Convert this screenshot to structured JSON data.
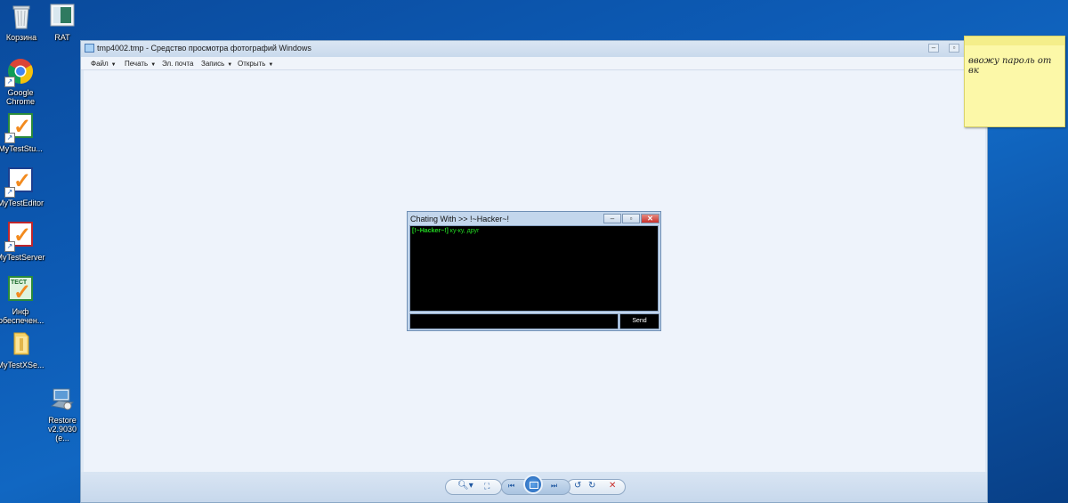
{
  "desktop": {
    "icons": [
      {
        "label": "Корзина",
        "icon": "recycle-bin-icon"
      },
      {
        "label": "RAT",
        "icon": "rat-file-icon"
      },
      {
        "label": "Google Chrome",
        "icon": "chrome-icon"
      },
      {
        "label": "MyTestStu...",
        "icon": "mytest-student-icon"
      },
      {
        "label": "MyTestEditor",
        "icon": "mytest-editor-icon"
      },
      {
        "label": "MyTestServer",
        "icon": "mytest-server-icon"
      },
      {
        "label": "Инф обеспечен...",
        "icon": "test-icon"
      },
      {
        "label": "MyTestXSe...",
        "icon": "folder-icon"
      },
      {
        "label": "Restore v2.9030 (e...",
        "icon": "restore-computer-icon"
      }
    ],
    "test_badge": "ТЕСТ"
  },
  "viewer": {
    "title": "tmp4002.tmp - Средство просмотра фотографий Windows",
    "menu": [
      "Файл",
      "Печать",
      "Эл. почта",
      "Запись",
      "Открыть"
    ],
    "toolbar_icons": [
      "zoom-icon",
      "actual-size-icon",
      "previous-icon",
      "slideshow-icon",
      "next-icon",
      "rotate-left-icon",
      "rotate-right-icon",
      "delete-icon"
    ]
  },
  "chat": {
    "title": "Chating With >> !~Hacker~!",
    "messages": [
      {
        "sender": "[!~Hacker~!]",
        "text": " ку-ку, друг"
      }
    ],
    "send_label": "Send"
  },
  "sticky": {
    "text": "ввожу пароль от вк"
  },
  "colors": {
    "desktop_bg": "#0d5bb5",
    "chat_text": "#21d621",
    "sticky_bg": "#fcf8a8",
    "close_red": "#c9302c"
  }
}
